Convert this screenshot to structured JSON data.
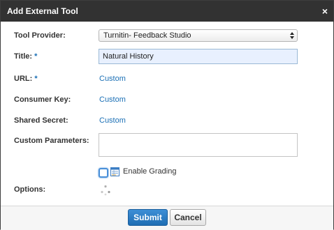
{
  "dialog": {
    "title": "Add External Tool",
    "close_glyph": "×"
  },
  "form": {
    "tool_provider": {
      "label": "Tool Provider:",
      "selected": "Turnitin- Feedback Studio"
    },
    "title": {
      "label": "Title:",
      "required_mark": "*",
      "value": "Natural History"
    },
    "url": {
      "label": "URL:",
      "required_mark": "*",
      "value": "Custom"
    },
    "consumer_key": {
      "label": "Consumer Key:",
      "value": "Custom"
    },
    "shared_secret": {
      "label": "Shared Secret:",
      "value": "Custom"
    },
    "custom_parameters": {
      "label": "Custom Parameters:",
      "value": ""
    },
    "enable_grading": {
      "label": "Enable Grading",
      "checked": false,
      "icon": "gradebook-icon"
    },
    "options": {
      "label": "Options:",
      "icon": "loading-spinner-icon"
    }
  },
  "footer": {
    "submit_label": "Submit",
    "cancel_label": "Cancel"
  },
  "colors": {
    "titlebar_bg": "#323232",
    "link": "#1a6fb5",
    "submit_bg": "#2a7cc4"
  }
}
